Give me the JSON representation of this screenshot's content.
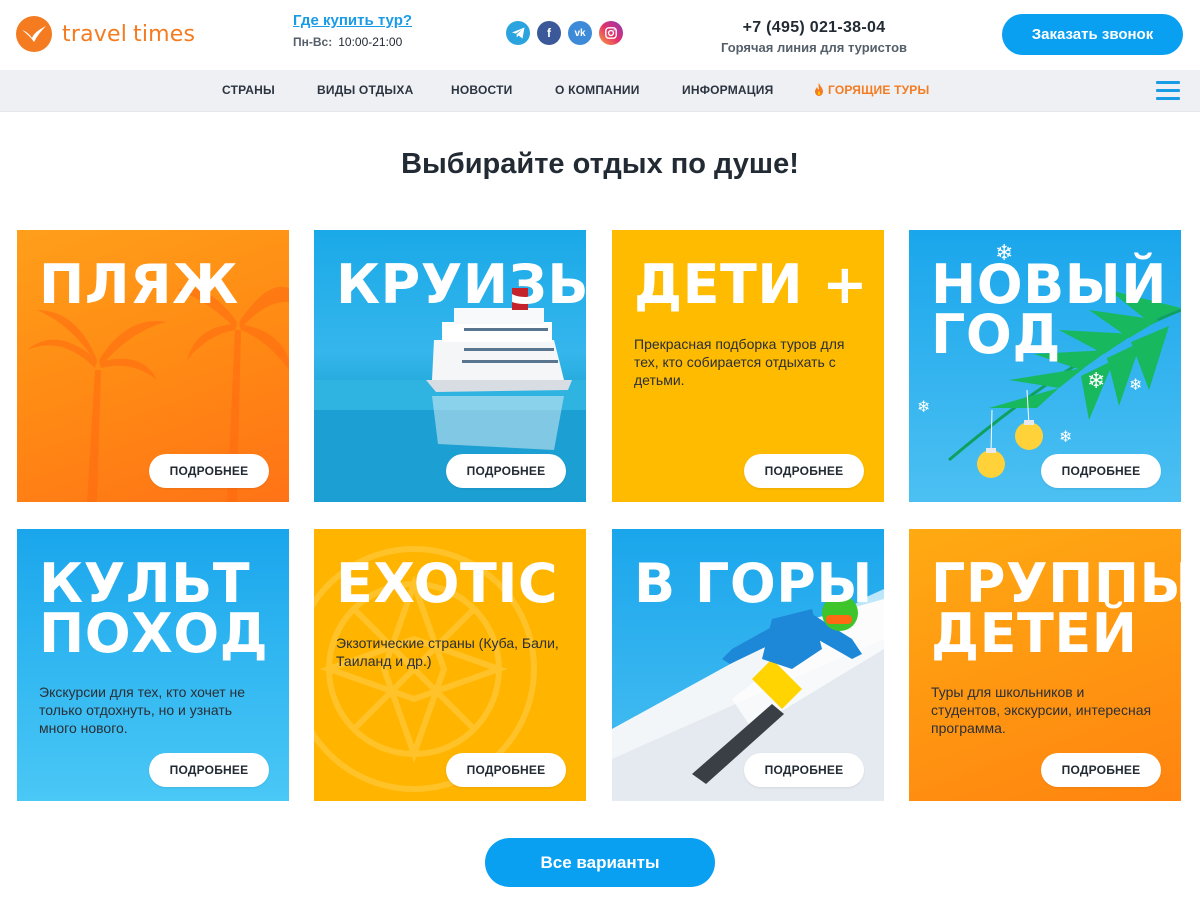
{
  "header": {
    "logo_word1": "travel",
    "logo_word2": "times",
    "buy_link": "Где купить тур?",
    "hours_days": "Пн-Вс:",
    "hours_time": "10:00-21:00",
    "socials": [
      "telegram-icon",
      "facebook-icon",
      "vk-icon",
      "instagram-icon"
    ],
    "phone": "+7 (495) 021-38-04",
    "hotline": "Горячая линия для туристов",
    "call_button": "Заказать звонок"
  },
  "nav": {
    "items": [
      "СТРАНЫ",
      "ВИДЫ ОТДЫХА",
      "НОВОСТИ",
      "О КОМПАНИИ",
      "ИНФОРМАЦИЯ",
      "ГОРЯЩИЕ ТУРЫ"
    ]
  },
  "title": "Выбирайте отдых по душе!",
  "cards": [
    {
      "title": "ПЛЯЖ",
      "desc": "",
      "button": "ПОДРОБНЕЕ"
    },
    {
      "title": "КРУИЗЫ",
      "desc": "",
      "button": "ПОДРОБНЕЕ"
    },
    {
      "title": "ДЕТИ +",
      "desc": "Прекрасная подборка туров для тех, кто собирается отдыхать с детьми.",
      "button": "ПОДРОБНЕЕ"
    },
    {
      "title_line1": "НОВЫЙ",
      "title_line2": "ГОД",
      "desc": "",
      "button": "ПОДРОБНЕЕ"
    },
    {
      "title_line1": "КУЛЬТ",
      "title_line2": "ПОХОД",
      "desc": "Экскурсии для тех, кто хочет не только отдохнуть, но и узнать много нового.",
      "button": "ПОДРОБНЕЕ"
    },
    {
      "title": "EXOTIC",
      "desc": "Экзотические страны (Куба, Бали, Таиланд и др.)",
      "button": "ПОДРОБНЕЕ"
    },
    {
      "title": "В ГОРЫ",
      "desc": "",
      "button": "ПОДРОБНЕЕ"
    },
    {
      "title_line1": "ГРУППЫ",
      "title_line2": "ДЕТЕЙ",
      "desc": "Туры для школьников и студентов, экскурсии, интересная программа.",
      "button": "ПОДРОБНЕЕ"
    }
  ],
  "all_button": "Все варианты",
  "colors": {
    "brand_orange": "#f47b20",
    "accent_blue": "#0aa0f2",
    "card_yellow": "#ffbb00"
  }
}
